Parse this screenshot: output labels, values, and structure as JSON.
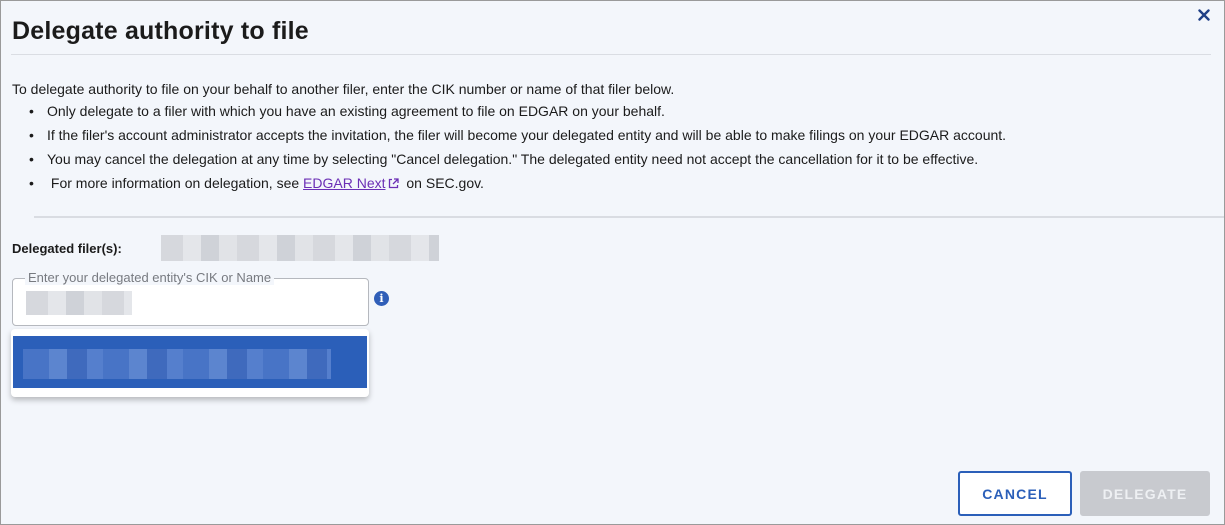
{
  "dialog": {
    "title": "Delegate authority to file",
    "close_label": "×",
    "intro": "To delegate authority to file on your behalf to another filer, enter the CIK number or name of that filer below.",
    "bullets": [
      "Only delegate to a filer with which you have an existing agreement to file on EDGAR on your behalf.",
      "If the filer's account administrator accepts the invitation, the filer will become your delegated entity and will be able to make filings on your EDGAR account.",
      "You may cancel the delegation at any time by selecting \"Cancel delegation.\" The delegated entity need not accept the cancellation for it to be effective."
    ],
    "more_info": {
      "prefix": "For more information on delegation, see ",
      "link_text": "EDGAR Next",
      "suffix": " on SEC.gov."
    }
  },
  "delegated": {
    "label": "Delegated filer(s):"
  },
  "search": {
    "legend": "Enter your delegated entity's CIK or Name"
  },
  "buttons": {
    "cancel": "CANCEL",
    "delegate": "DELEGATE"
  },
  "icons": {
    "close": "close-icon",
    "external_link": "external-link-icon",
    "info": "info-icon"
  },
  "colors": {
    "accent": "#2b5fb9",
    "link": "#6b2fb5",
    "disabled": "#c8cacf"
  }
}
